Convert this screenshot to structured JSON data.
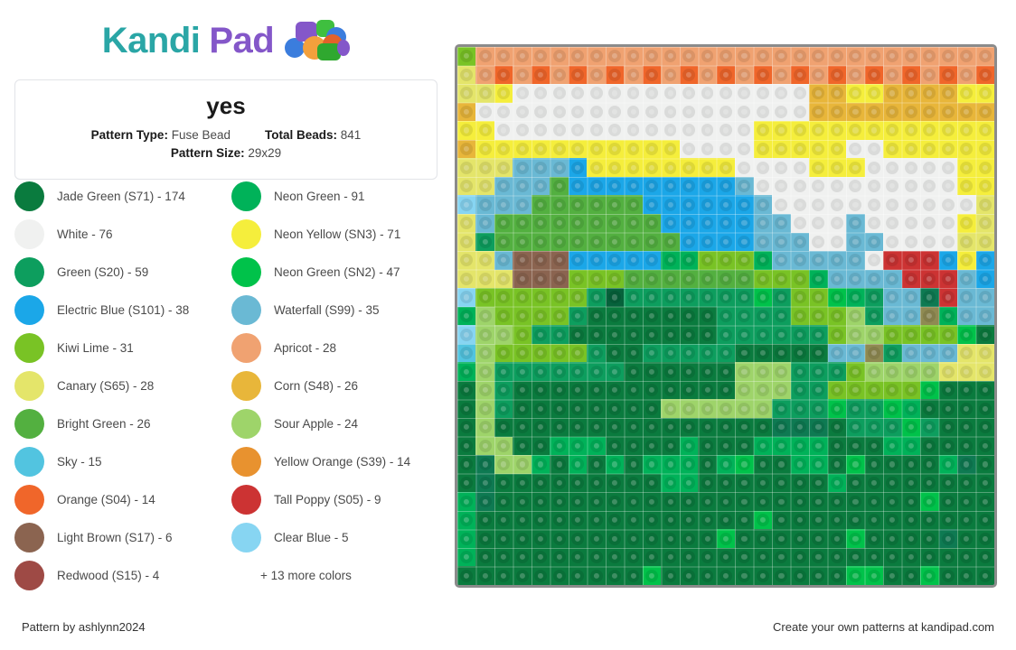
{
  "brand": {
    "name_part1": "Kandi",
    "name_part2": "Pad",
    "icon": "bead-cluster-icon",
    "color_part1": "#2aa6a6",
    "color_part2": "#8457c9"
  },
  "info_card": {
    "title": "yes",
    "pattern_type_label": "Pattern Type:",
    "pattern_type_value": "Fuse Bead",
    "total_beads_label": "Total Beads:",
    "total_beads_value": "841",
    "pattern_size_label": "Pattern Size:",
    "pattern_size_value": "29x29"
  },
  "legend": {
    "more_text": "+ 13 more colors",
    "items": [
      {
        "name": "Jade Green (S71)",
        "count": 174,
        "label": "Jade Green (S71) - 174",
        "color": "#0a7b3e"
      },
      {
        "name": "Neon Green",
        "count": 91,
        "label": "Neon Green - 91",
        "color": "#00b259"
      },
      {
        "name": "White",
        "count": 76,
        "label": "White - 76",
        "color": "#f0f1f0"
      },
      {
        "name": "Neon Yellow (SN3)",
        "count": 71,
        "label": "Neon Yellow (SN3) - 71",
        "color": "#f5ee3c"
      },
      {
        "name": "Green (S20)",
        "count": 59,
        "label": "Green (S20) - 59",
        "color": "#0d9e5e"
      },
      {
        "name": "Neon Green (SN2)",
        "count": 47,
        "label": "Neon Green (SN2) - 47",
        "color": "#00c24a"
      },
      {
        "name": "Electric Blue (S101)",
        "count": 38,
        "label": "Electric Blue (S101) - 38",
        "color": "#1ba7e8"
      },
      {
        "name": "Waterfall (S99)",
        "count": 35,
        "label": "Waterfall (S99) - 35",
        "color": "#6ab9d4"
      },
      {
        "name": "Kiwi Lime",
        "count": 31,
        "label": "Kiwi Lime - 31",
        "color": "#79c325"
      },
      {
        "name": "Apricot",
        "count": 28,
        "label": "Apricot - 28",
        "color": "#f0a271"
      },
      {
        "name": "Canary (S65)",
        "count": 28,
        "label": "Canary (S65) - 28",
        "color": "#e4e56a"
      },
      {
        "name": "Corn (S48)",
        "count": 26,
        "label": "Corn (S48) - 26",
        "color": "#e8b63a"
      },
      {
        "name": "Bright Green",
        "count": 26,
        "label": "Bright Green - 26",
        "color": "#53b040"
      },
      {
        "name": "Sour Apple",
        "count": 24,
        "label": "Sour Apple - 24",
        "color": "#9ed46a"
      },
      {
        "name": "Sky",
        "count": 15,
        "label": "Sky - 15",
        "color": "#52c4e0"
      },
      {
        "name": "Yellow Orange (S39)",
        "count": 14,
        "label": "Yellow Orange (S39) - 14",
        "color": "#e8922f"
      },
      {
        "name": "Orange (S04)",
        "count": 14,
        "label": "Orange (S04) - 14",
        "color": "#f0662a"
      },
      {
        "name": "Tall Poppy (S05)",
        "count": 9,
        "label": "Tall Poppy (S05) - 9",
        "color": "#cc3333"
      },
      {
        "name": "Light Brown (S17)",
        "count": 6,
        "label": "Light Brown (S17) - 6",
        "color": "#8b6450"
      },
      {
        "name": "Clear Blue",
        "count": 5,
        "label": "Clear Blue - 5",
        "color": "#87d5f2"
      },
      {
        "name": "Redwood (S15)",
        "count": 4,
        "label": "Redwood (S15) - 4",
        "color": "#9e4a45"
      }
    ]
  },
  "pattern": {
    "rows": 29,
    "cols": 29,
    "palette": {
      "J": "#0a7b3e",
      "N": "#00b259",
      "W": "#f0f1f0",
      "Y": "#f5ee3c",
      "G": "#0d9e5e",
      "n": "#00c24a",
      "E": "#1ba7e8",
      "F": "#6ab9d4",
      "K": "#79c325",
      "A": "#f0a271",
      "C": "#e4e56a",
      "R": "#e8b63a",
      "B": "#53b040",
      "S": "#9ed46a",
      "Q": "#52c4e0",
      "O": "#e8922f",
      "o": "#f0662a",
      "T": "#cc3333",
      "L": "#8b6450",
      "U": "#87d5f2",
      "D": "#9e4a45",
      "t": "#0e7a52",
      "d": "#06623b",
      "h": "#8f8a52"
    },
    "grid": [
      "KAAAAAAAAAAAAAAAAAAAAAAAAAAAA",
      "CAoAoAoAoAoAoAoAoAoAoAoAoAoAo",
      "CCYWWWWWWWWWWWWWWWWRRYYRRRRYY",
      "RWWWWWWWWWWWWWWWWWWRRRRRRRRRR",
      "YYWWWWWWWWWWWWWWYYYYYYYYYYYYY",
      "RYYYYYYYYYYYWWWWYYYYYWWYYYYYY",
      "CCCFFFEYYYYYYYYWWWWYYYWWWWWYY",
      "CCFFFBEEEEEEEEEFWWWWWWWWWWWYY",
      "UFFFBBBBBBEEEEEEFWWWWWWWWWWWC",
      "CFBBBBBBBBBEEEEEFFWWWFWWWWWYC",
      "CGBBBBBBBBBBEEEEFFFWWFFWWWWCC",
      "CCFLLLEEEEENNKKKNFFFFFWTTTEYE",
      "CCCLLLKKKBBBBBBBKKKNFFFFTTTFEE",
      "UKKKKKKGdGGGGGGGnGKKnNGFFtTFFFC",
      "NSKKKKGJJJJJJJGGGGKKKSGFFhNFFCC",
      "USSKGGJJJJJJJJGGGGGGKSSKKKKnJJJ",
      "QSKKKKKGJJGGGGGJJJJJFFhGFFFCCC",
      "NSGGGGGGGJJJJJJSSSGGGKSSSSCCC",
      "JSGJJJJJJJJJJJJSSSGGKKKKKnJJJ",
      "JSGJJJJJJJJSSSSSSGGGnGGnNJJJJ",
      "JSJJJJJJJJJJJJJJJtttJGGGnGJJJ",
      "JSSJJNNNJJJJNJJJNNNNJJJNNJJJJ",
      "JtSSNJNJNJNNNJNnJJNNJnJJJJNtJ",
      "JtJJJJJJJJJNNJJJJJJJNJJJJJJJJ",
      "NtJJJJJJJJJJJJJJJJJJJJJJJnJJJ",
      "NJJJJJJJJJJJJJJJnJJJJJJJJJJJJ",
      "NJJJJJJJJJJJJJnJJJJJJnJJJJtJJ",
      "NJJJJJJJJJJJJJJJJJJJJJJJJJJJJ",
      "JJJJJJJJJJnJJJJJJJJJJnnJJnJJJ"
    ]
  },
  "footer": {
    "author_text": "Pattern by ashlynn2024",
    "promo_text": "Create your own patterns at kandipad.com"
  }
}
